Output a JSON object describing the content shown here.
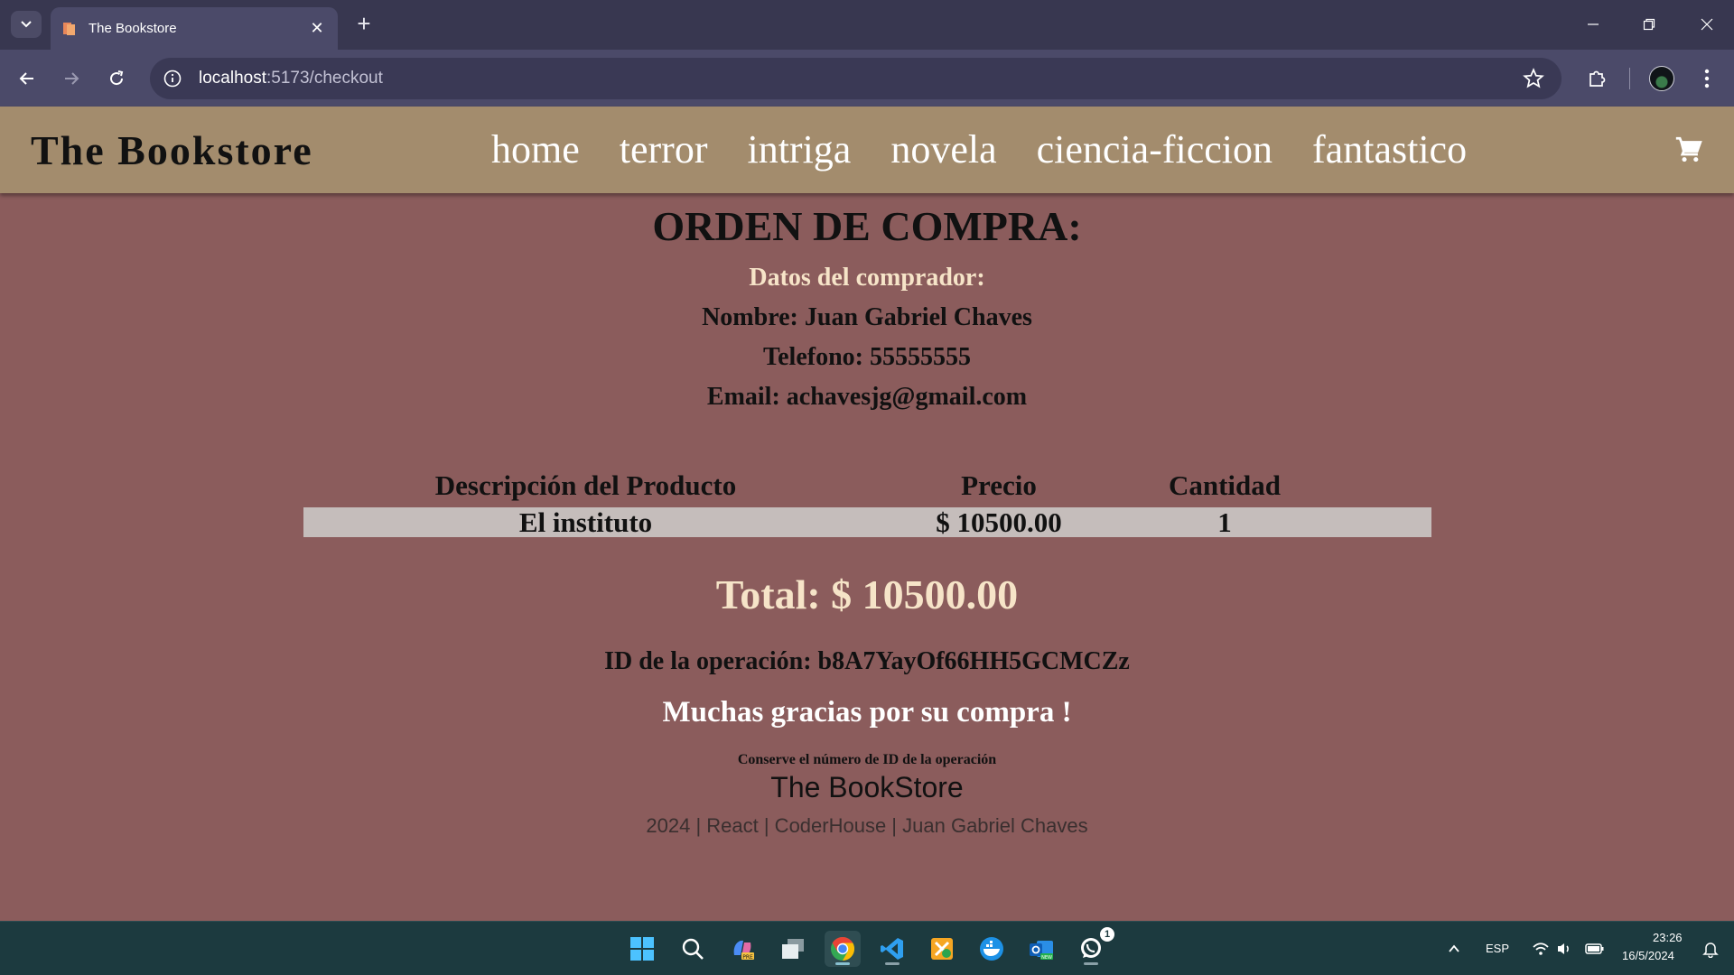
{
  "browser": {
    "tab_title": "The Bookstore",
    "url_host": "localhost",
    "url_path": ":5173/checkout",
    "accent_color": "#4b4a69"
  },
  "site": {
    "brand": "The Bookstore",
    "nav": [
      "home",
      "terror",
      "intriga",
      "novela",
      "ciencia-ficcion",
      "fantastico"
    ],
    "cart_icon": "shopping-cart-icon",
    "header_color": "#a38c6d",
    "background_color": "#8b5c5c"
  },
  "order": {
    "title": "ORDEN DE COMPRA:",
    "buyer_heading": "Datos del comprador:",
    "name_line": "Nombre: Juan Gabriel Chaves",
    "phone_line": "Telefono: 55555555",
    "email_line": "Email: achavesjg@gmail.com",
    "table": {
      "headers": [
        "Descripción del Producto",
        "Precio",
        "Cantidad"
      ],
      "rows": [
        [
          "El instituto",
          "$ 10500.00",
          "1"
        ]
      ]
    },
    "total": "Total: $ 10500.00",
    "operation_id": "ID de la operación: b8A7YayOf66HH5GCMCZz",
    "thanks": "Muchas gracias por su compra !",
    "keep_note": "Conserve el número de ID de la operación"
  },
  "footer": {
    "brand": "The BookStore",
    "credits": "2024 | React | CoderHouse | Juan Gabriel Chaves"
  },
  "taskbar": {
    "language": "ESP",
    "time": "23:26",
    "date": "16/5/2024",
    "whatsapp_badge": "1",
    "apps": [
      "windows-start-icon",
      "search-icon",
      "copilot-icon",
      "task-view-icon",
      "chrome-icon",
      "vscode-icon",
      "xampp-icon",
      "docker-icon",
      "outlook-icon",
      "whatsapp-icon"
    ]
  }
}
